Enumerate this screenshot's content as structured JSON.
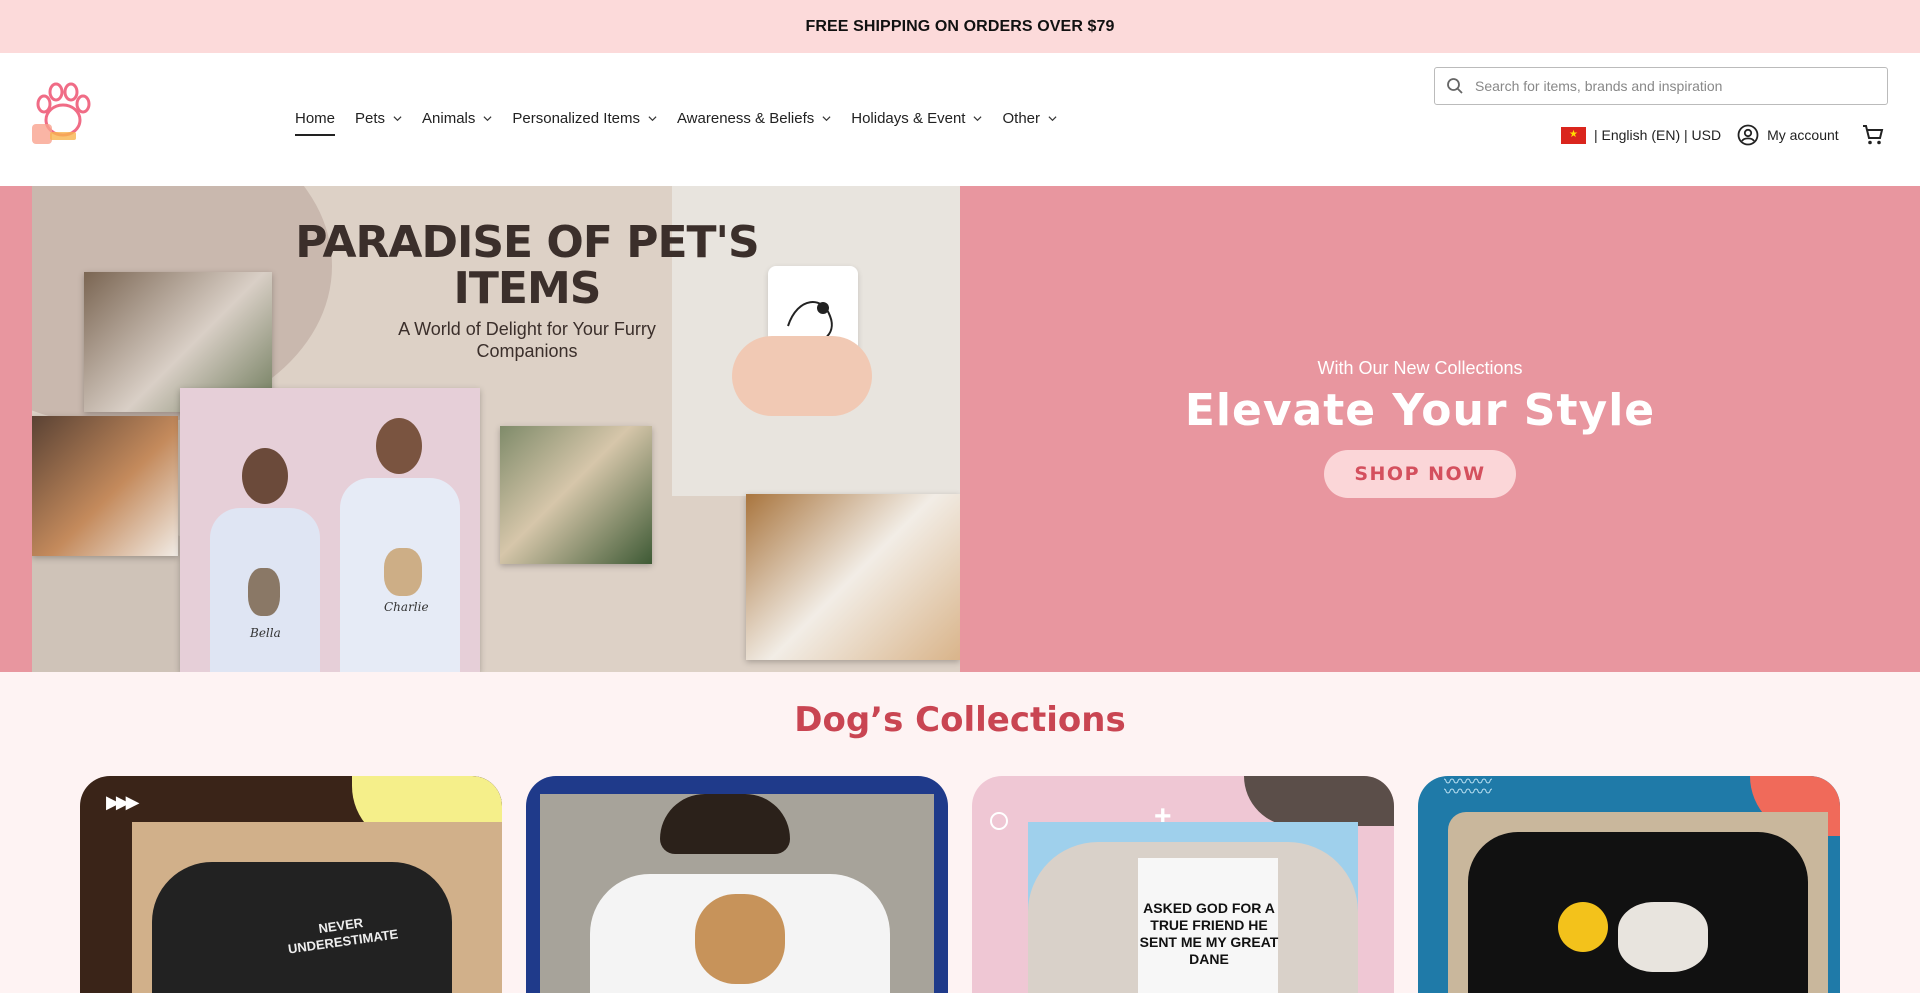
{
  "announcement": "FREE SHIPPING ON ORDERS OVER $79",
  "nav": {
    "items": [
      {
        "label": "Home"
      },
      {
        "label": "Pets"
      },
      {
        "label": "Animals"
      },
      {
        "label": "Personalized Items"
      },
      {
        "label": "Awareness & Beliefs"
      },
      {
        "label": "Holidays & Event"
      },
      {
        "label": "Other"
      }
    ]
  },
  "search": {
    "placeholder": "Search for items, brands and inspiration"
  },
  "utils": {
    "locale": "| English (EN) | USD",
    "account": "My account"
  },
  "hero": {
    "image_title": "PARADISE OF PET'S ITEMS",
    "image_subtitle": "A World of Delight for Your Furry Companions",
    "tee_name_1": "Bella",
    "tee_name_2": "Charlie",
    "pretitle": "With Our New Collections",
    "title": "Elevate Your Style",
    "cta": "SHOP NOW"
  },
  "collections": {
    "title": "Dog’s Collections",
    "cards": [
      {
        "print": "NEVER UNDERESTIMATE"
      },
      {
        "print": ""
      },
      {
        "print": "ASKED GOD FOR A TRUE FRIEND HE SENT ME MY GREAT DANE"
      },
      {
        "print": ""
      }
    ]
  },
  "colors": {
    "announce_bg": "#fcdada",
    "hero_bg": "#e8969f",
    "accent": "#c94552",
    "section_bg": "#fef3f3"
  }
}
